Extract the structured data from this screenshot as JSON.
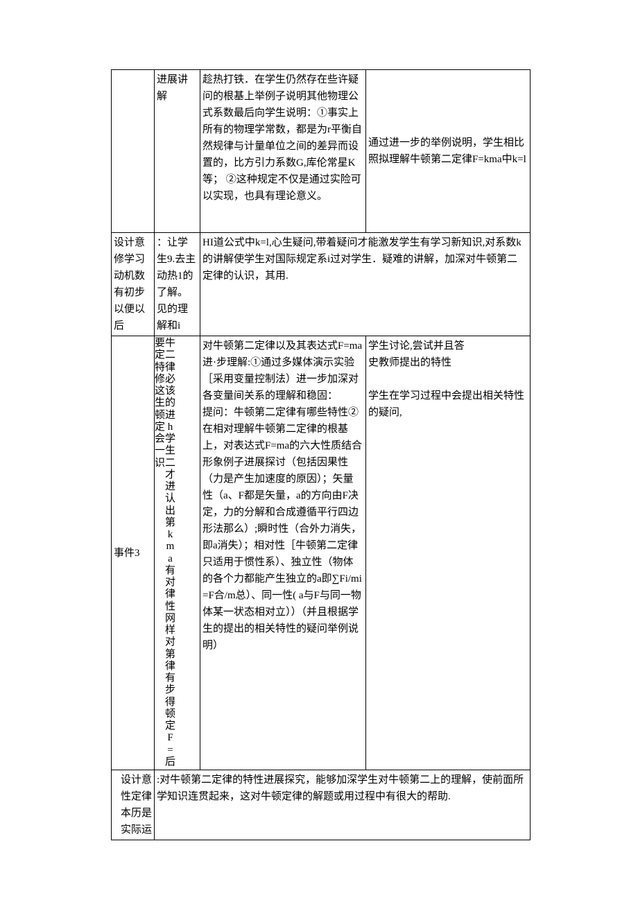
{
  "row1": {
    "c2": "进展讲解",
    "c3": "趁热打铁．在学生仍然存在些许疑问的根基上举例子说明其他物理公式系数最后向学生说明：①事实上所有的物理学常数，都是为r平衡自然规律与计量单位之间的差异而设置的，比方引力系数G,库伦常星K等； ②这种规定不仅是通过实险可以实现，也具有理论意义。",
    "c4": "通过进一步的举例说明，学生相比照拟理解牛顿第二定律F=kma中k=l"
  },
  "row2": {
    "c1": "设计意修学习动机数有初步以便以后",
    "c2": "：让学生9.去主动热1的了解。见的理解和i",
    "c3": "HI道公式中k=l,心生疑问,带着疑问才能激发学生有学习新知识,对系数k的讲解使学生对国际规定系i过对学生．疑难的讲解，加深对牛顿第二定律的认识，其用."
  },
  "row3": {
    "c1": "事件3",
    "c2a": "要定特修这生顿定会一识",
    "c2b": "牛二律必该的进h学生二才进认出第kma有对律性网样对第律有步得顿定F=后",
    "c3": "对牛顿第二定律以及其表达式F=ma进·步理解:①通过多媒体演示实验［采用变量控制法）进一步加深对各变量间关系的理解和稳固：\n提问：牛顿第二定律有哪些特性②在相对理解牛顿第二定律的根基上，对表达式F=ma的六大性质结合形象例子进展探讨（包括因果性（力是产生加速度的原因）；矢量性（a、F都是矢量，a的方向由F决定，力的分解和合成遵循平行四边形法那么）;瞬时性（合外力消失，即a消失）；相对性［牛顿第二定律只适用于惯性系）、独立性（物体的各个力都能产生独立的a即∑Fi/mi=F合/m总）、同一性( a与F与同一物体某一状态相对立））（并且根据学生的提出的相关特性的疑问举例说明）",
    "c4": "学生讨论,尝试并且答\n史教师提出的特性\n\n学生在学习过程中会提出相关特性的疑问,"
  },
  "row4": {
    "c1": "设计意性定律本历是实际运",
    "c2": ":对牛顿第二定律的特性进展探究，能够加深学生对牛顿第二上的理解，使前面所学知识连贯起来，这对牛顿定律的解题或用过程中有很大的帮助."
  }
}
